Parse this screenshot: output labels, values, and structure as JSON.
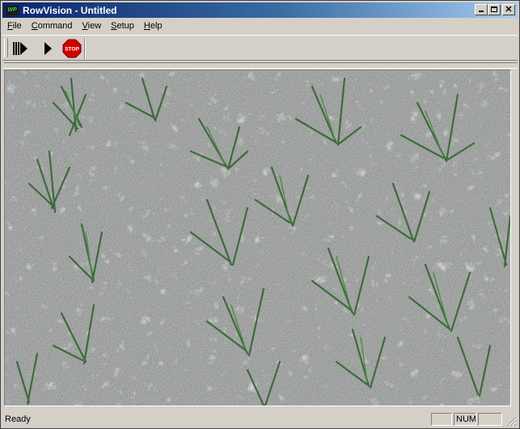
{
  "window": {
    "title": "RowVision - Untitled",
    "app_icon_text": "WP",
    "close_glyph": "✕"
  },
  "menu": {
    "items": [
      {
        "hotkey": "F",
        "rest": "ile"
      },
      {
        "hotkey": "C",
        "rest": "ommand"
      },
      {
        "hotkey": "V",
        "rest": "iew"
      },
      {
        "hotkey": "S",
        "rest": "etup"
      },
      {
        "hotkey": "H",
        "rest": "elp"
      }
    ]
  },
  "toolbar": {
    "buttons": [
      "fast-forward-icon",
      "play-icon",
      "stop-sign-icon"
    ],
    "stop_label": "STOP"
  },
  "viewport": {
    "content": "camera-image"
  },
  "status": {
    "text": "Ready",
    "num_indicator": "NUM",
    "cap_indicator": "",
    "scrl_indicator": ""
  }
}
